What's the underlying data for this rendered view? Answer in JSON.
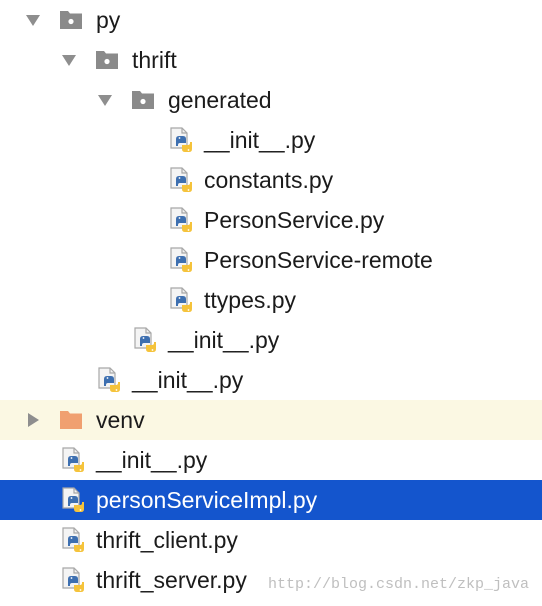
{
  "colors": {
    "selection_bg": "#1455cd",
    "excluded_bg": "#fbf8e3",
    "package_folder": "#8a8a8a",
    "venv_folder": "#f0a070",
    "python_blue": "#3d6fb0",
    "python_yellow": "#f5c33b",
    "text": "#1b1b1b",
    "selected_text": "#ffffff"
  },
  "tree": {
    "items": [
      {
        "label": "py",
        "kind": "package",
        "expanded": true,
        "icon": "package-folder-icon"
      },
      {
        "label": "thrift",
        "kind": "package",
        "expanded": true,
        "icon": "package-folder-icon"
      },
      {
        "label": "generated",
        "kind": "package",
        "expanded": true,
        "icon": "package-folder-icon"
      },
      {
        "label": "__init__.py",
        "kind": "python",
        "icon": "python-file-icon"
      },
      {
        "label": "constants.py",
        "kind": "python",
        "icon": "python-file-icon"
      },
      {
        "label": "PersonService.py",
        "kind": "python",
        "icon": "python-file-icon"
      },
      {
        "label": "PersonService-remote",
        "kind": "python",
        "icon": "python-file-icon"
      },
      {
        "label": "ttypes.py",
        "kind": "python",
        "icon": "python-file-icon"
      },
      {
        "label": "__init__.py",
        "kind": "python",
        "icon": "python-file-icon"
      },
      {
        "label": "__init__.py",
        "kind": "python",
        "icon": "python-file-icon"
      },
      {
        "label": "venv",
        "kind": "folder",
        "expanded": false,
        "excluded": true,
        "icon": "excluded-folder-icon"
      },
      {
        "label": "__init__.py",
        "kind": "python",
        "icon": "python-file-icon"
      },
      {
        "label": "personServiceImpl.py",
        "kind": "python",
        "selected": true,
        "icon": "python-file-icon"
      },
      {
        "label": "thrift_client.py",
        "kind": "python",
        "icon": "python-file-icon"
      },
      {
        "label": "thrift_server.py",
        "kind": "python",
        "icon": "python-file-icon"
      }
    ]
  },
  "watermark": "http://blog.csdn.net/zkp_java"
}
